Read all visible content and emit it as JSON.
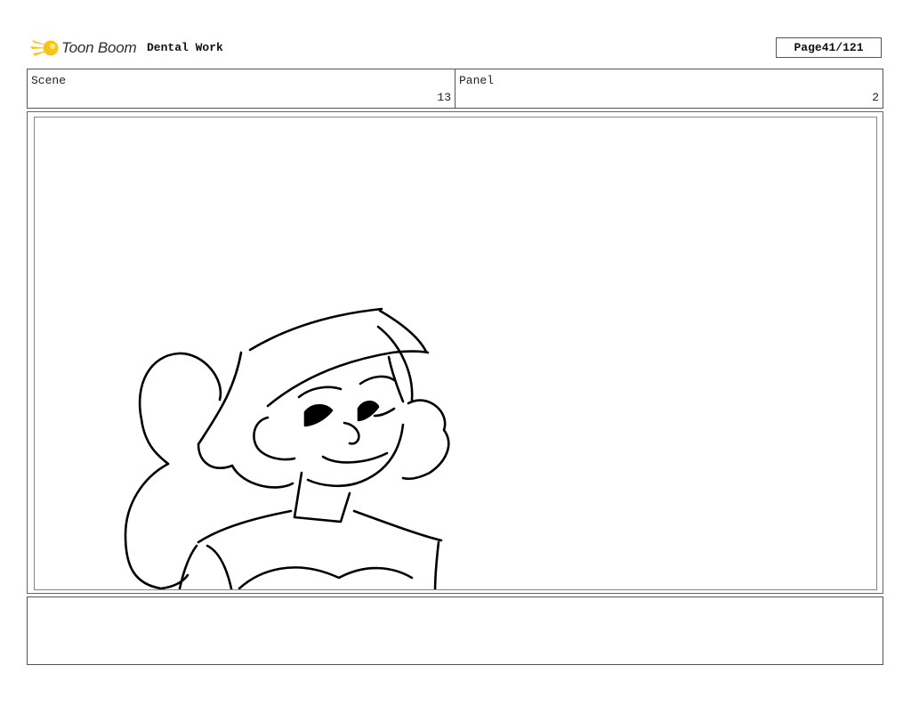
{
  "header": {
    "logo_text": "Toon Boom",
    "project_title": "Dental Work",
    "page_label": "Page",
    "page_number": "41/121"
  },
  "scene": {
    "label": "Scene",
    "value": "13"
  },
  "panel": {
    "label": "Panel",
    "value": "2"
  },
  "drawing": {
    "subject": "girl-portrait-sketch",
    "stroke_color": "#000000"
  },
  "notes": {
    "text": ""
  },
  "colors": {
    "logo_accent": "#f5c518",
    "border": "#555555"
  }
}
